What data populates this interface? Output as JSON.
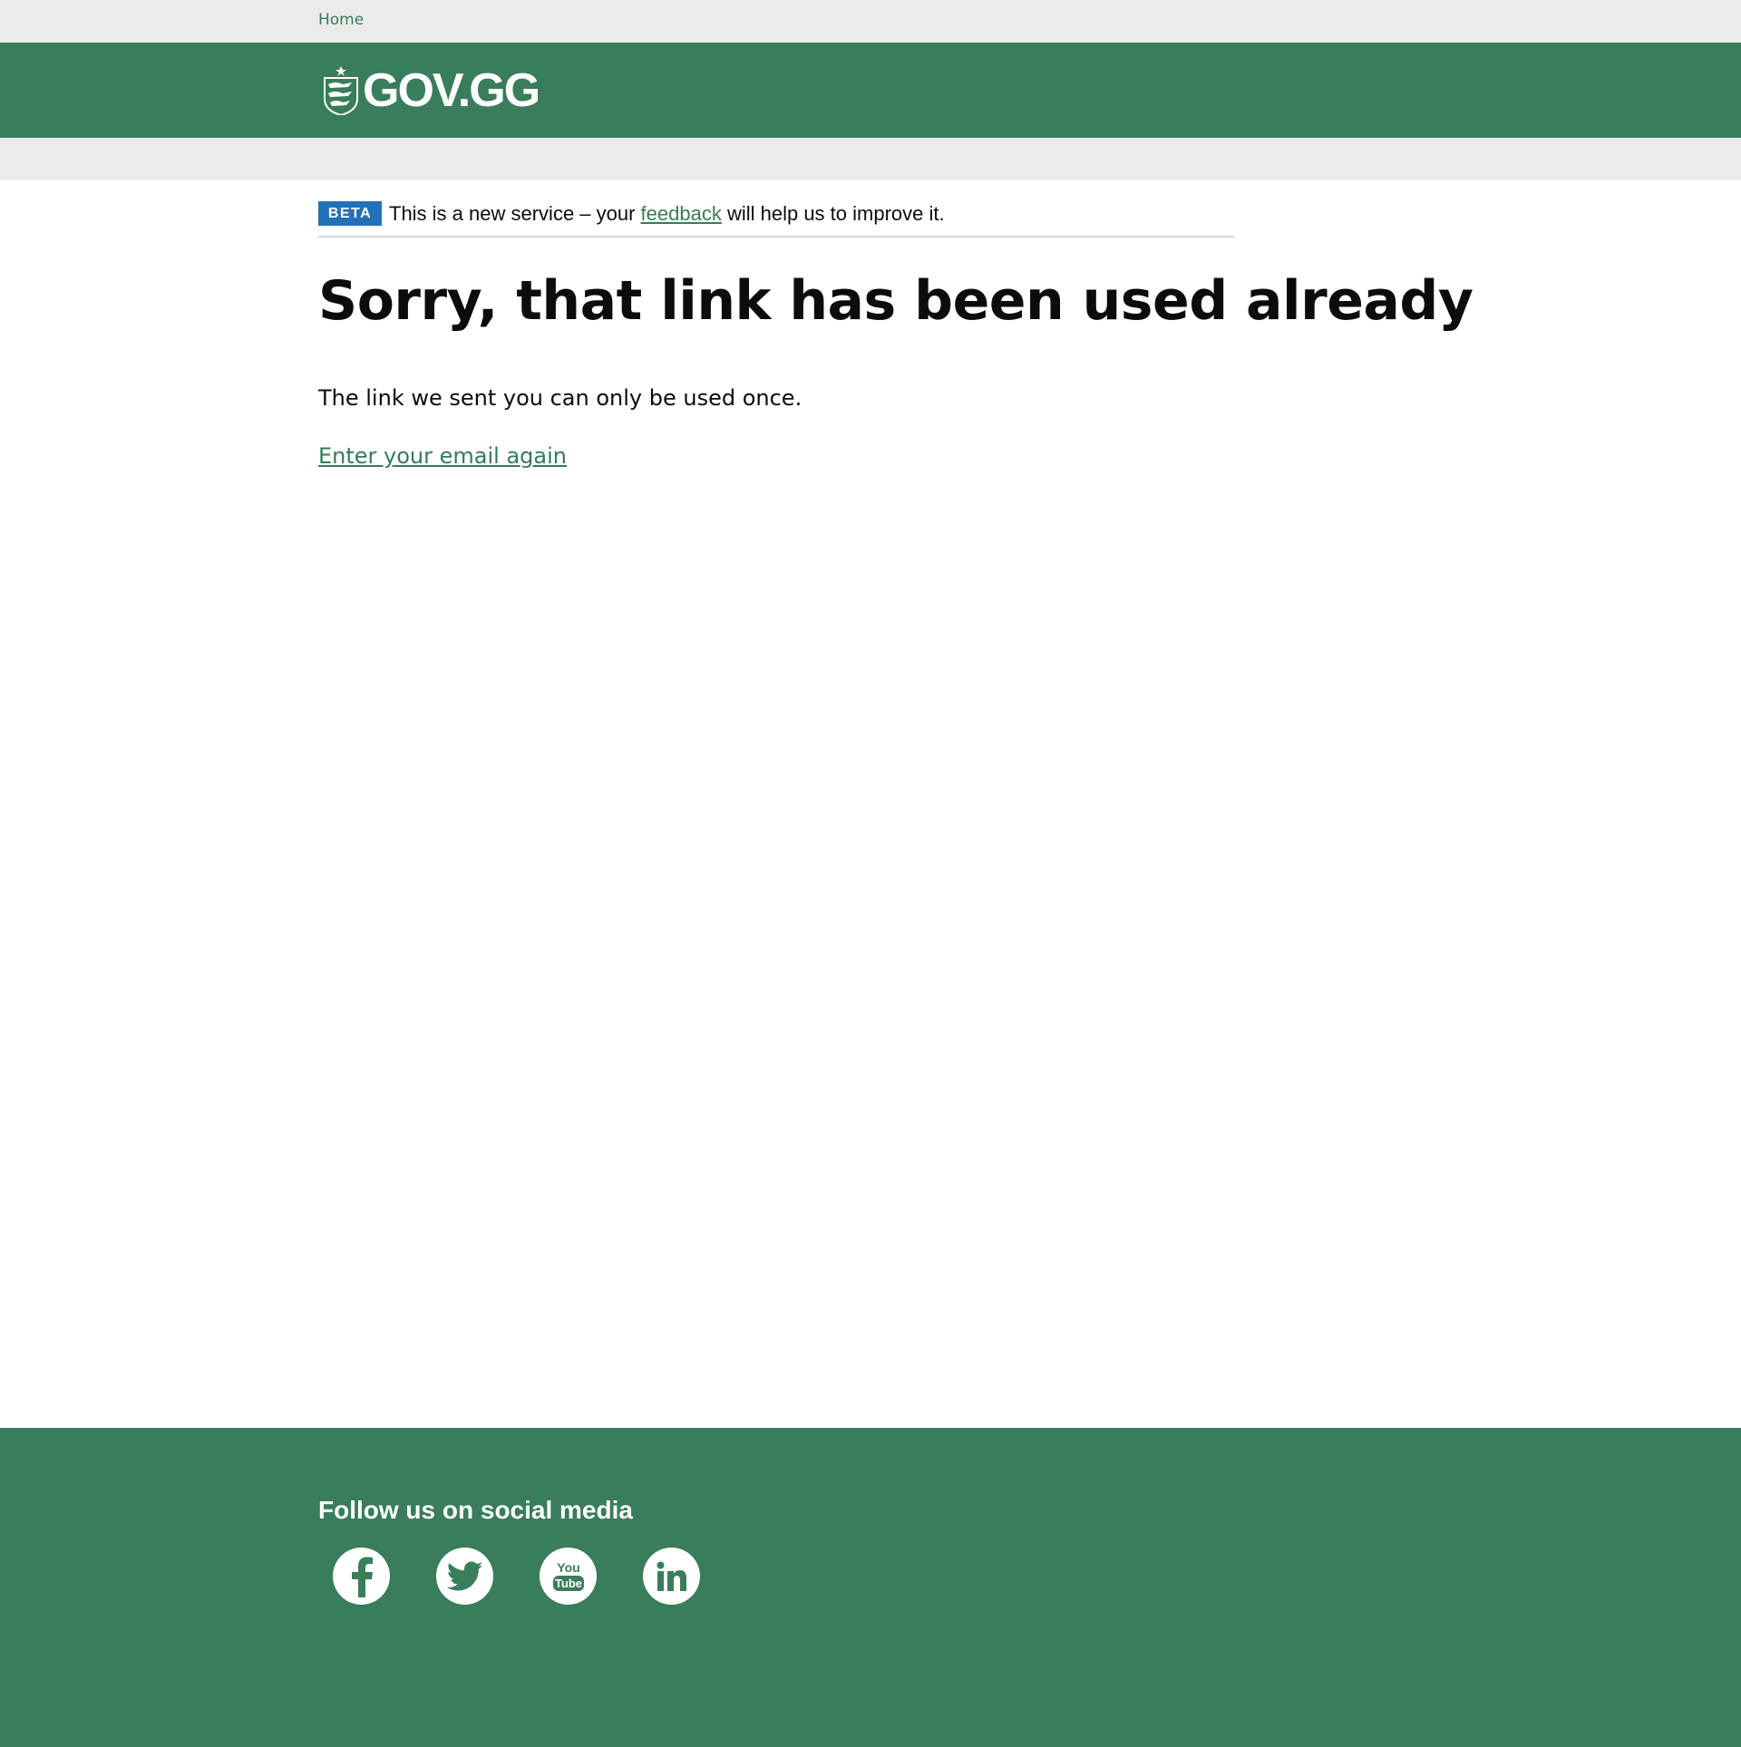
{
  "topbar": {
    "home_link": "Home"
  },
  "header": {
    "logo_text": "GOV.GG"
  },
  "beta_banner": {
    "tag": "BETA",
    "text_before": "This is a new service – your ",
    "link": "feedback",
    "text_after": " will help us to improve it."
  },
  "main": {
    "title": "Sorry, that link has been used already",
    "message": "The link we sent you can only be used once.",
    "retry_link": "Enter your email again"
  },
  "footer": {
    "heading": "Follow us on social media",
    "social": [
      {
        "icon": "facebook-icon"
      },
      {
        "icon": "twitter-icon"
      },
      {
        "icon": "youtube-icon",
        "text_top": "You",
        "text_bottom": "Tube"
      },
      {
        "icon": "linkedin-icon"
      }
    ]
  },
  "colors": {
    "brand_green": "#397d5a",
    "link_green": "#367b58",
    "beta_blue": "#2271b8",
    "grey_bar": "#ebebeb"
  }
}
